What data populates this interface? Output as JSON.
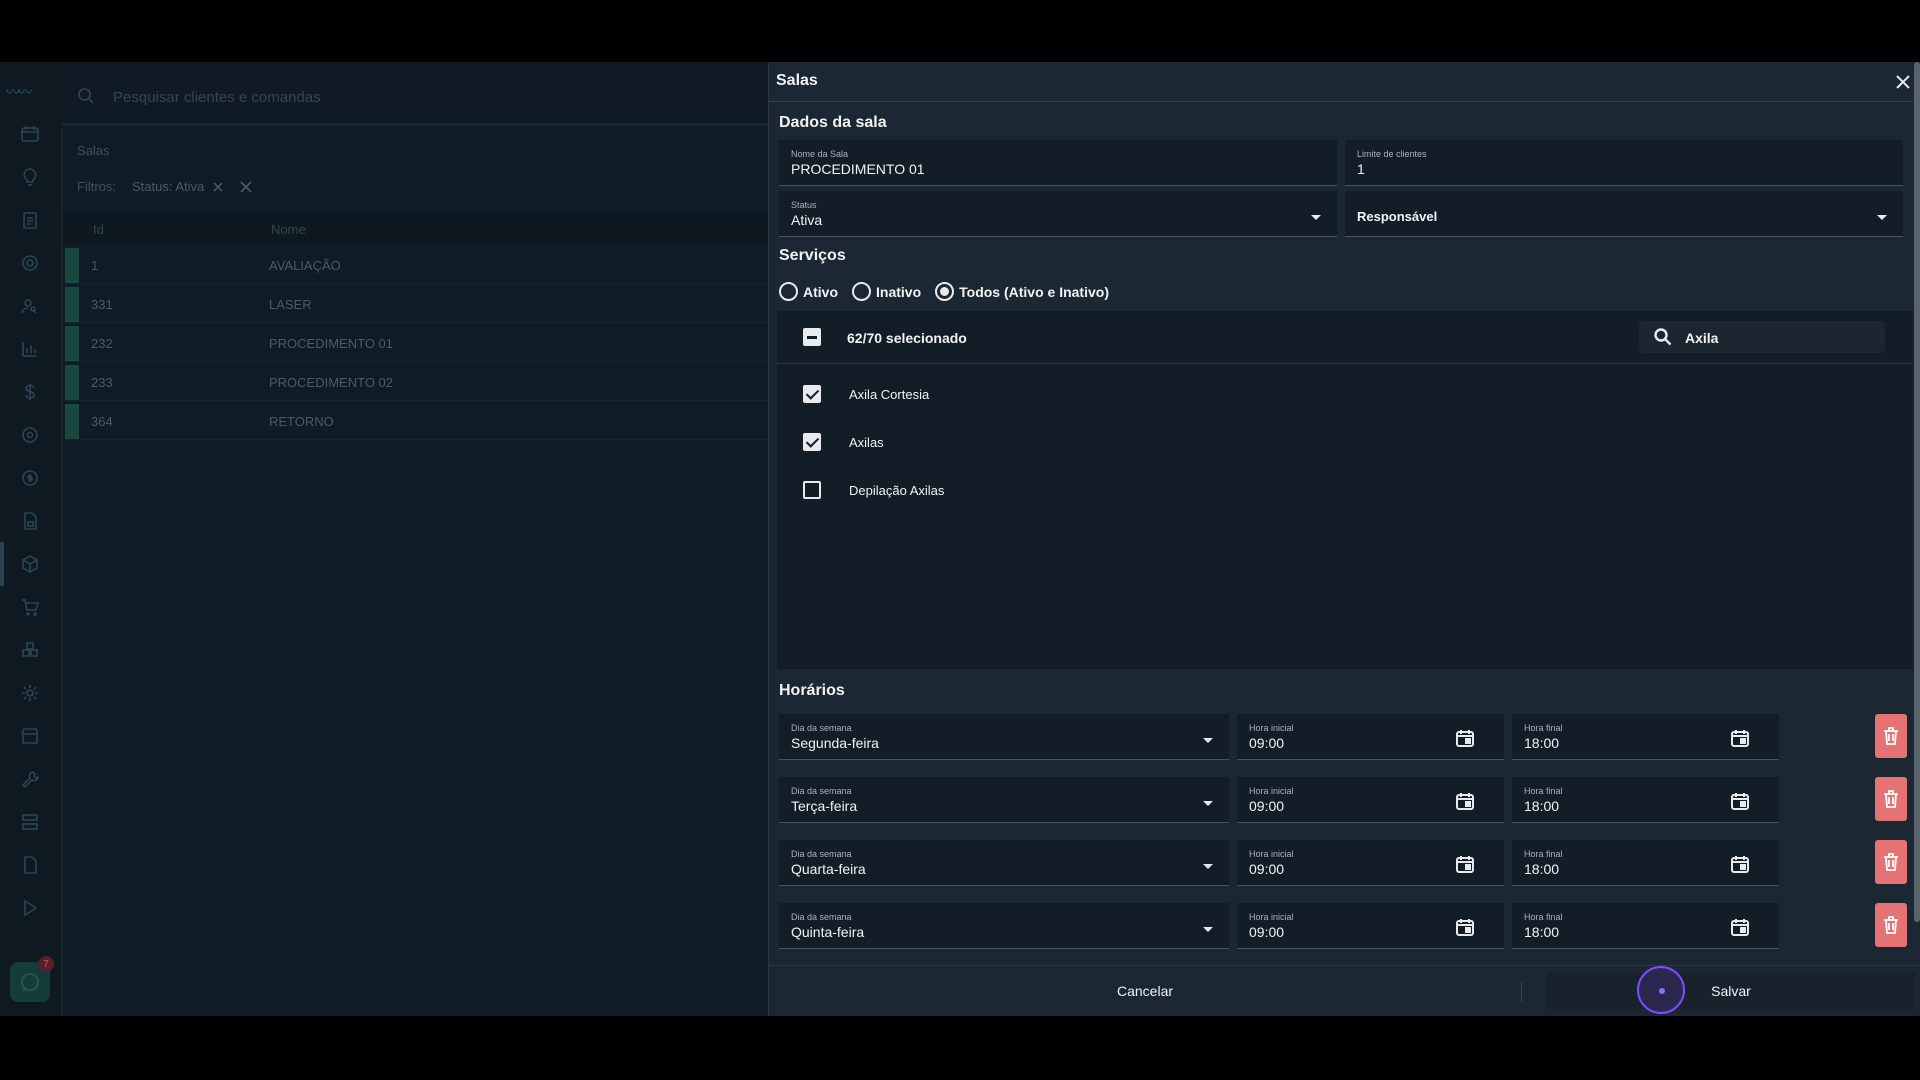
{
  "background": {
    "search_placeholder": "Pesquisar clientes e comandas",
    "breadcrumb": "Salas",
    "filters_label": "Filtros:",
    "filter_chip": "Status: Ativa",
    "columns": [
      "Id",
      "Nome"
    ],
    "rows": [
      {
        "id": "1",
        "name": "AVALIAÇÃO"
      },
      {
        "id": "331",
        "name": "LASER"
      },
      {
        "id": "232",
        "name": "PROCEDIMENTO 01"
      },
      {
        "id": "233",
        "name": "PROCEDIMENTO 02"
      },
      {
        "id": "364",
        "name": "RETORNO"
      }
    ],
    "chat_badge": "7"
  },
  "modal": {
    "title": "Salas",
    "dados_section": "Dados da sala",
    "nome_label": "Nome da Sala",
    "nome_value": "PROCEDIMENTO 01",
    "limite_label": "Limite de clientes",
    "limite_value": "1",
    "status_label": "Status",
    "status_value": "Ativa",
    "responsavel_label": "Responsável",
    "servicos_section": "Serviços",
    "radio_options": [
      "Ativo",
      "Inativo",
      "Todos (Ativo e Inativo)"
    ],
    "radio_selected": "Todos (Ativo e Inativo)",
    "selected_count": "62/70 selecionado",
    "service_search_value": "Axila",
    "services": [
      {
        "name": "Axila Cortesia",
        "checked": true
      },
      {
        "name": "Axilas",
        "checked": true
      },
      {
        "name": "Depilação Axilas",
        "checked": false
      }
    ],
    "horarios_section": "Horários",
    "dia_label": "Dia da semana",
    "inicio_label": "Hora inicial",
    "fim_label": "Hora final",
    "schedules": [
      {
        "day": "Segunda-feira",
        "start": "09:00",
        "end": "18:00"
      },
      {
        "day": "Terça-feira",
        "start": "09:00",
        "end": "18:00"
      },
      {
        "day": "Quarta-feira",
        "start": "09:00",
        "end": "18:00"
      },
      {
        "day": "Quinta-feira",
        "start": "09:00",
        "end": "18:00"
      }
    ],
    "cancel_label": "Cancelar",
    "save_label": "Salvar"
  },
  "colors": {
    "delete_button": "#e57373",
    "cursor_ring": "#7c4dff",
    "modal_bg": "#1b2733"
  }
}
